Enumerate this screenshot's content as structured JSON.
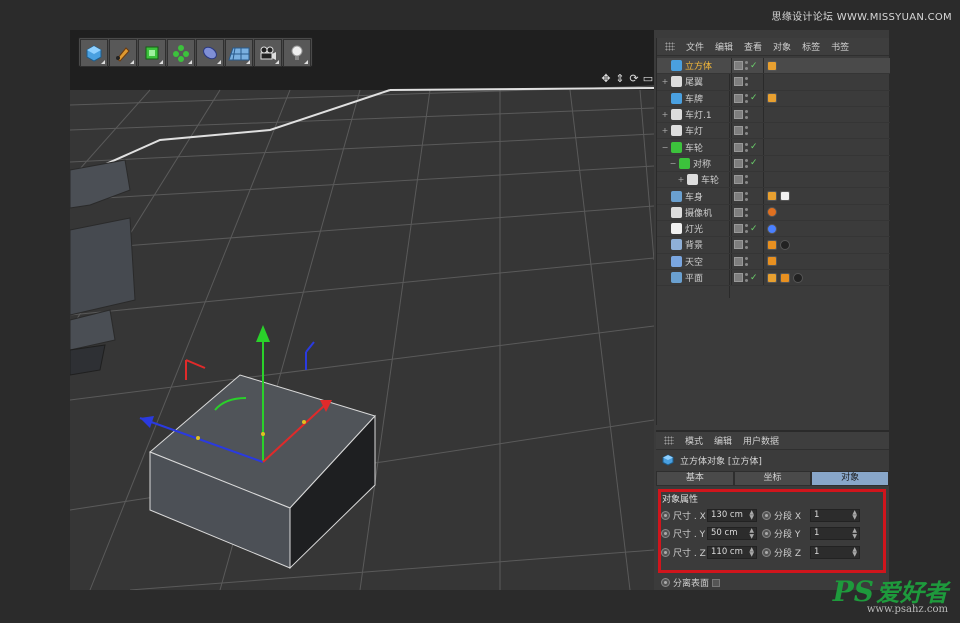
{
  "watermark": {
    "top": "思缘设计论坛 WWW.MISSYUAN.COM",
    "brand1": "PS",
    "brand2": "爱好者",
    "url": "www.psahz.com"
  },
  "toolbar": {
    "tools": [
      "cube-tool-icon",
      "pen-tool-icon",
      "subdivision-tool-icon",
      "array-tool-icon",
      "deformer-tool-icon",
      "floor-tool-icon",
      "camera-tool-icon",
      "light-tool-icon"
    ]
  },
  "object_manager": {
    "menu": [
      "文件",
      "编辑",
      "查看",
      "对象",
      "标签",
      "书签"
    ],
    "objects": [
      {
        "name": "立方体",
        "fold": "",
        "icon": "cube",
        "selected": true,
        "check": true,
        "tags": [
          "phong"
        ]
      },
      {
        "name": "尾翼",
        "fold": "+",
        "icon": "null",
        "selected": false,
        "check": false,
        "tags": []
      },
      {
        "name": "车牌",
        "fold": "",
        "icon": "cube",
        "selected": false,
        "check": true,
        "tags": [
          "phong"
        ]
      },
      {
        "name": "车灯.1",
        "fold": "+",
        "icon": "null",
        "selected": false,
        "check": false,
        "tags": []
      },
      {
        "name": "车灯",
        "fold": "+",
        "icon": "null",
        "selected": false,
        "check": false,
        "tags": []
      },
      {
        "name": "车轮",
        "fold": "−",
        "icon": "symmetry",
        "selected": false,
        "check": true,
        "tags": []
      },
      {
        "name": "对称",
        "fold": "−",
        "icon": "symmetry",
        "selected": false,
        "check": true,
        "tags": [],
        "indent": 1
      },
      {
        "name": "车轮",
        "fold": "+",
        "icon": "null",
        "selected": false,
        "check": false,
        "tags": [],
        "indent": 2
      },
      {
        "name": "车身",
        "fold": "",
        "icon": "poly",
        "selected": false,
        "check": false,
        "tags": [
          "phong",
          "checker"
        ]
      },
      {
        "name": "摄像机",
        "fold": "",
        "icon": "camera",
        "selected": false,
        "check": false,
        "tags": [
          "target"
        ]
      },
      {
        "name": "灯光",
        "fold": "",
        "icon": "light",
        "selected": false,
        "check": true,
        "tags": [
          "ring"
        ]
      },
      {
        "name": "背景",
        "fold": "",
        "icon": "background",
        "selected": false,
        "check": false,
        "tags": [
          "film",
          "sphere"
        ]
      },
      {
        "name": "天空",
        "fold": "",
        "icon": "sky",
        "selected": false,
        "check": false,
        "tags": [
          "film"
        ]
      },
      {
        "name": "平面",
        "fold": "",
        "icon": "plane",
        "selected": false,
        "check": true,
        "tags": [
          "phong",
          "film",
          "sphere"
        ]
      }
    ]
  },
  "attribute_manager": {
    "menu": [
      "模式",
      "编辑",
      "用户数据"
    ],
    "title": "立方体对象 [立方体]",
    "tabs": [
      "基本",
      "坐标",
      "对象"
    ],
    "active_tab": 2,
    "section": "对象属性",
    "props": [
      {
        "label": "尺寸 . X",
        "value": "130 cm",
        "seg_label": "分段 X",
        "seg_value": "1"
      },
      {
        "label": "尺寸 . Y",
        "value": "50 cm",
        "seg_label": "分段 Y",
        "seg_value": "1"
      },
      {
        "label": "尺寸 . Z",
        "value": "110 cm",
        "seg_label": "分段 Z",
        "seg_value": "1"
      }
    ],
    "separate_surfaces": "分离表面"
  },
  "colors": {
    "accent": "#88a6c9",
    "selected_text": "#f4b83a",
    "highlight": "#d0151c",
    "axis_x": "#e02a2a",
    "axis_y": "#2ad12a",
    "axis_z": "#2a3ae0"
  }
}
